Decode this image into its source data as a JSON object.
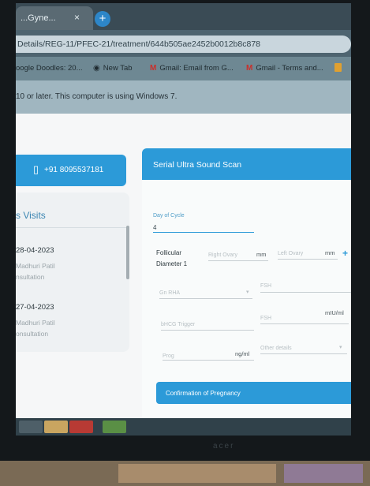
{
  "browser": {
    "tab_title": "...Gyne...",
    "tab_close": "×",
    "new_tab_label": "+",
    "url": "Details/REG-11/PFEC-21/treatment/644b505ae2452b0012b8c878",
    "bookmarks": [
      {
        "label": "oogle Doodles: 20...",
        "icon": ""
      },
      {
        "label": "New Tab",
        "icon": "globe-icon"
      },
      {
        "label": "Gmail: Email from G...",
        "icon": "gmail-icon"
      },
      {
        "label": "Gmail - Terms and...",
        "icon": "gmail-icon"
      }
    ],
    "info_bar_text": "10 or later. This computer is using Windows 7."
  },
  "contact": {
    "phone": "+91 8095537181"
  },
  "visits": {
    "title": "s Visits",
    "items": [
      {
        "date": "28-04-2023",
        "doctor": "Madhuri Patil",
        "type": "nsultation"
      },
      {
        "date": "27-04-2023",
        "doctor": "Madhuri Patil",
        "type": "onsultation"
      }
    ]
  },
  "scan": {
    "title": "Serial Ultra Sound Scan",
    "day_of_cycle_label": "Day of Cycle",
    "day_of_cycle_value": "4",
    "follicular_label_1": "Follicular",
    "follicular_label_2": "Diameter 1",
    "right_ovary_placeholder": "Right Ovary",
    "left_ovary_placeholder": "Left Ovary",
    "unit_mm": "mm",
    "add_label": "+",
    "gn_rha_placeholder": "Gn RHA",
    "fsh_placeholder_1": "FSH",
    "bhcg_trigger_placeholder": "bHCG Trigger",
    "fsh_placeholder_2": "FSH",
    "unit_miu_ml": "mIU/ml",
    "prog_placeholder": "Prog",
    "unit_ng_ml": "ng/ml",
    "other_details_placeholder": "Other details",
    "confirm_label": "Confirmation of Pregnancy"
  },
  "monitor": {
    "brand": "acer"
  },
  "colors": {
    "accent": "#2c9ad8",
    "tab_strip": "#3a4b55"
  }
}
